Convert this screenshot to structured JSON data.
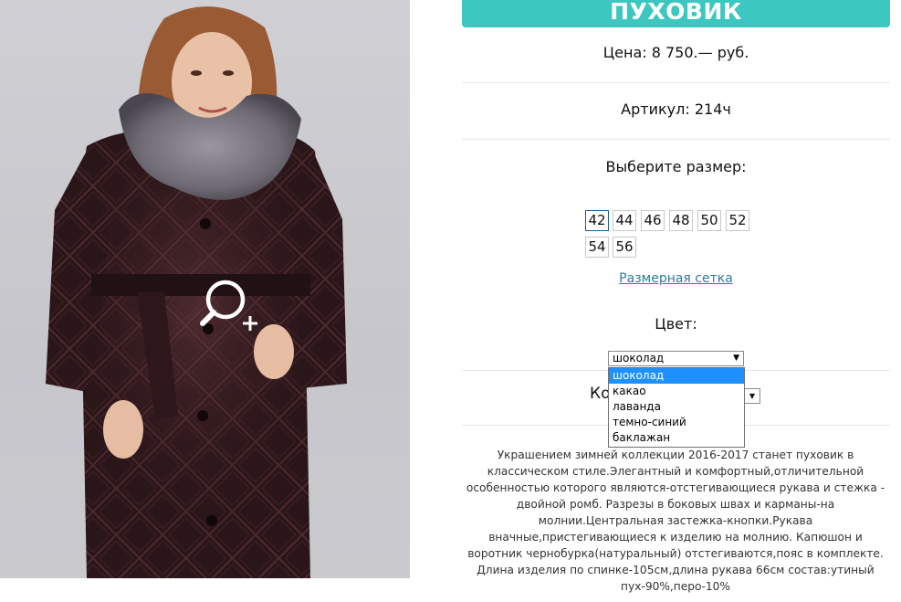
{
  "product": {
    "title": "ПУХОВИК",
    "price": "Цена: 8 750.— руб.",
    "article": "Артикул: 214ч",
    "size_prompt": "Выберите размер:",
    "sizes": [
      "42",
      "44",
      "46",
      "48",
      "50",
      "52",
      "54",
      "56"
    ],
    "selected_size": "42",
    "size_chart_link": "Размерная сетка",
    "color_label": "Цвет:",
    "color_selected": "шоколад",
    "color_options": [
      "шоколад",
      "какао",
      "лаванда",
      "темно-синий",
      "баклажан"
    ],
    "quantity_label_partial": "Ко",
    "description": "Украшением зимней коллекции 2016-2017 станет пуховик в классическом стиле.Элегантный и комфортный,отличительной особенностью которого являются-отстегивающиеся рукава и стежка - двойной ромб. Разрезы в боковых швах и карманы-на молнии.Центральная застежка-кнопки.Рукава вначные,пристегивающиеся к изделию на молнию. Капюшон и воротник чернобурка(натуральный) отстегиваются,пояс в комплекте. Длина изделия по спинке-105см,длина рукава 66см состав:утиный пух-90%,перо-10%"
  },
  "icons": {
    "zoom": "zoom-in-icon",
    "dropdown_arrow": "triangle-down-icon"
  },
  "colors": {
    "title_bar": "#3cc7c1",
    "link": "#2a7d9a",
    "highlight": "#1e90ff"
  }
}
